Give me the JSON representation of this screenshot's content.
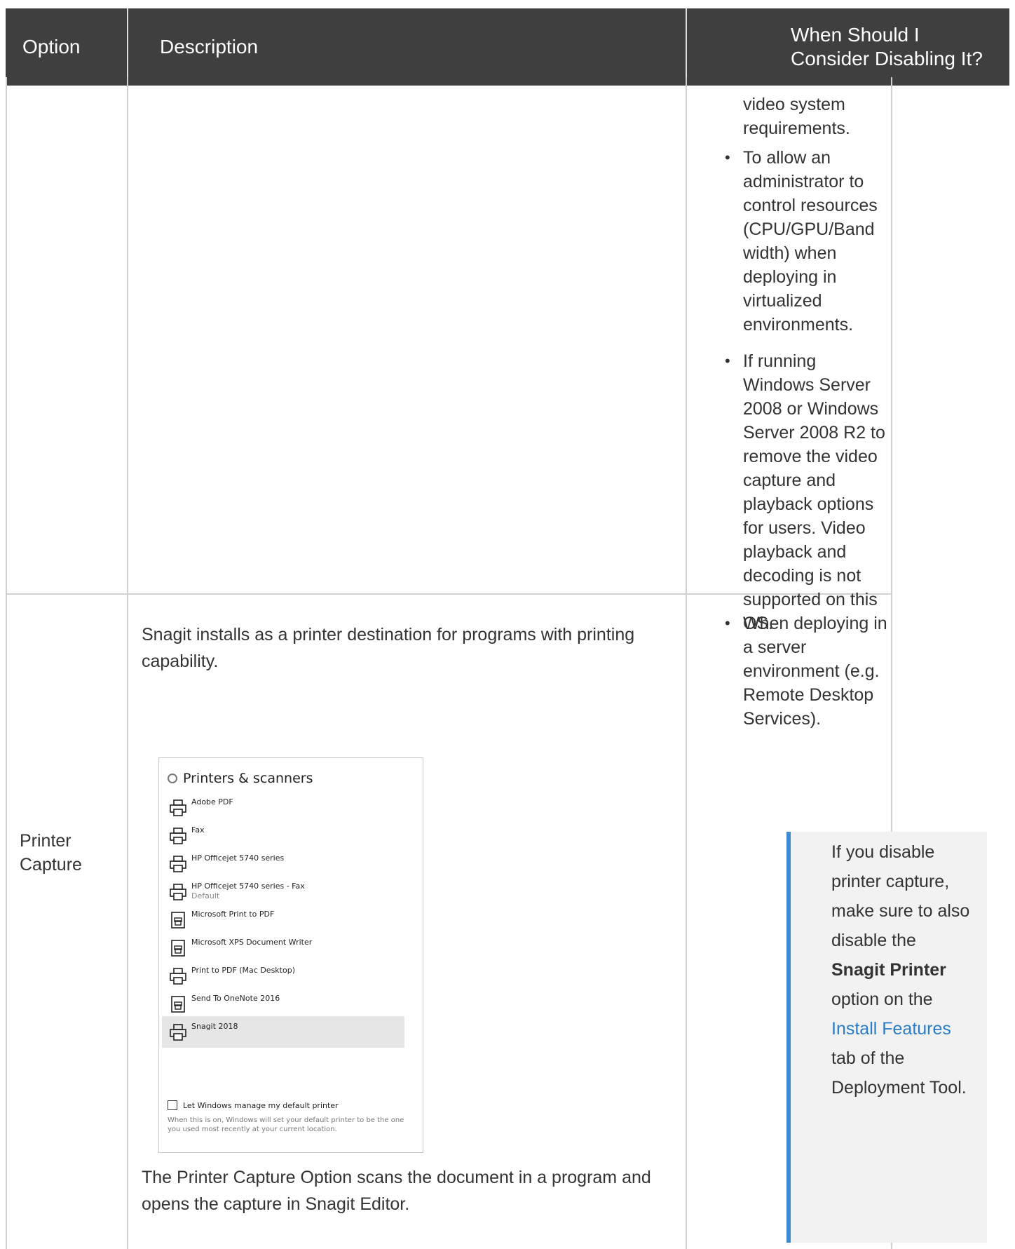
{
  "header": {
    "col_option": "Option",
    "col_description": "Description",
    "col_when": "When Should I Consider Disabling It?"
  },
  "row1": {
    "when_lead": "video system requirements.",
    "when_bullets": [
      "To allow an administrator to control resources (CPU/GPU/Band width) when deploying in virtualized environments.",
      "If running Windows Server 2008 or Windows Server 2008 R2 to remove the video capture and playback options for users. Video playback and decoding is not supported on this OS."
    ]
  },
  "row2": {
    "option": "Printer Capture",
    "desc_intro": "Snagit installs as a printer destination for programs with printing capability.",
    "desc_outro": "The Printer Capture Option scans the document in a program and opens the capture in Snagit Editor.",
    "when_bullets": [
      "When deploying in a server environment (e.g. Remote Desktop Services)."
    ],
    "note": {
      "pre": "If you disable printer capture, make sure to also disable the ",
      "bold": "Snagit Printer",
      "mid": " option on the ",
      "link": "Install Features",
      "post": " tab of the Deployment Tool."
    }
  },
  "screenshot": {
    "title": "Printers & scanners",
    "printers": [
      {
        "name": "Adobe PDF",
        "sub": "",
        "icon": "printer-icon"
      },
      {
        "name": "Fax",
        "sub": "",
        "icon": "printer-icon"
      },
      {
        "name": "HP Officejet 5740 series",
        "sub": "",
        "icon": "printer-icon"
      },
      {
        "name": "HP Officejet 5740 series - Fax",
        "sub": "Default",
        "icon": "printer-icon"
      },
      {
        "name": "Microsoft Print to PDF",
        "sub": "",
        "icon": "document-printer-icon"
      },
      {
        "name": "Microsoft XPS Document Writer",
        "sub": "",
        "icon": "document-printer-icon"
      },
      {
        "name": "Print to PDF (Mac Desktop)",
        "sub": "",
        "icon": "printer-icon"
      },
      {
        "name": "Send To OneNote 2016",
        "sub": "",
        "icon": "document-printer-icon"
      },
      {
        "name": "Snagit 2018",
        "sub": "",
        "icon": "printer-icon"
      }
    ],
    "checkbox_label": "Let Windows manage my default printer",
    "checkbox_desc": "When this is on, Windows will set your default printer to be the one you used most recently at your current location."
  }
}
